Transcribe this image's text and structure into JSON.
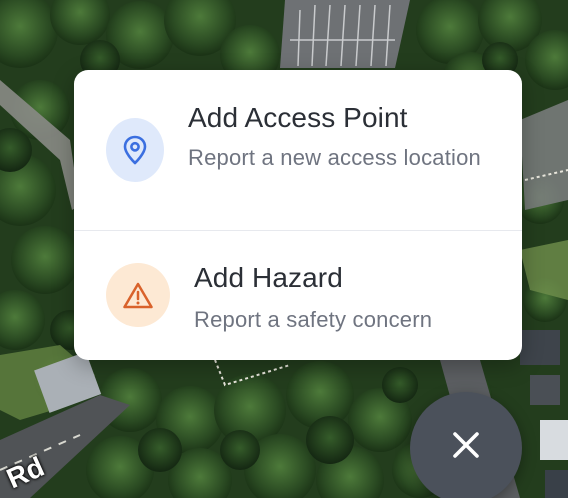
{
  "menu": {
    "items": [
      {
        "title": "Add Access Point",
        "description": "Report a new access location",
        "icon": "map-pin-icon",
        "icon_color": "#3b6fe0",
        "icon_bg": "#dfe9fb"
      },
      {
        "title": "Add Hazard",
        "description": "Report a safety concern",
        "icon": "warning-triangle-icon",
        "icon_color": "#d9622b",
        "icon_bg": "#fde9d4"
      }
    ]
  },
  "close_button": {
    "icon": "close-icon",
    "background": "#4b515b"
  },
  "map": {
    "label": "Rd"
  }
}
